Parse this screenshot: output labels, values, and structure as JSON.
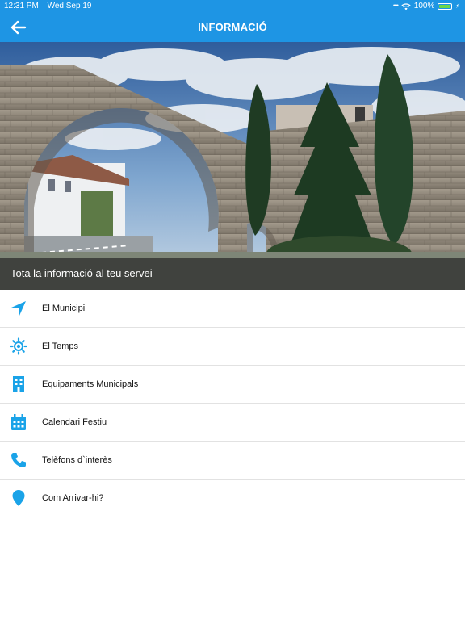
{
  "status_bar": {
    "time": "12:31 PM",
    "date": "Wed Sep 19",
    "battery": "100%"
  },
  "nav": {
    "title": "INFORMACIÓ",
    "back_icon": "arrow-left-icon"
  },
  "hero": {
    "caption": "Tota la informació al teu servei"
  },
  "menu": {
    "items": [
      {
        "label": "El Municipi",
        "icon": "navigation-arrow-icon"
      },
      {
        "label": "El Temps",
        "icon": "sun-icon"
      },
      {
        "label": "Equipaments Municipals",
        "icon": "building-icon"
      },
      {
        "label": "Calendari Festiu",
        "icon": "calendar-icon"
      },
      {
        "label": "Telèfons d`interès",
        "icon": "phone-icon"
      },
      {
        "label": "Com Arrivar-hi?",
        "icon": "map-pin-icon"
      }
    ]
  },
  "colors": {
    "accent": "#1e95e4",
    "icon": "#1aa3e8"
  }
}
